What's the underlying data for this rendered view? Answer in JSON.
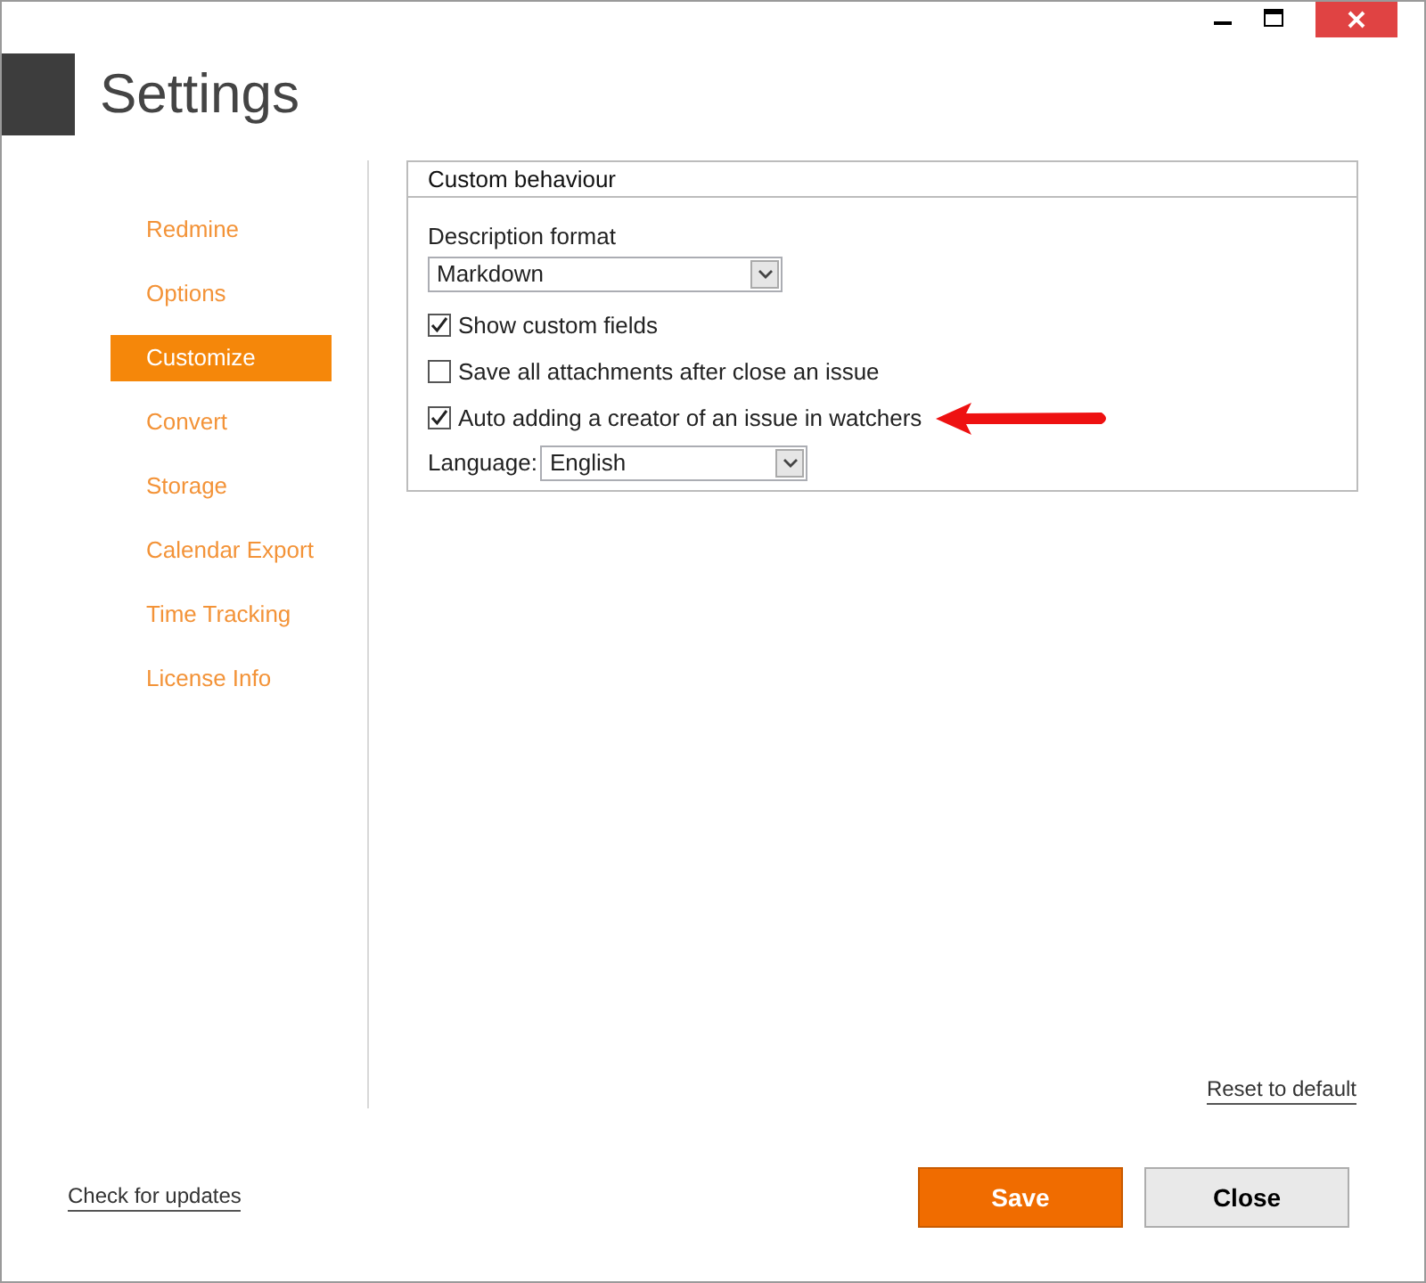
{
  "window": {
    "title": "Settings"
  },
  "sidebar": {
    "items": [
      {
        "label": "Redmine",
        "selected": false
      },
      {
        "label": "Options",
        "selected": false
      },
      {
        "label": "Customize",
        "selected": true
      },
      {
        "label": "Convert",
        "selected": false
      },
      {
        "label": "Storage",
        "selected": false
      },
      {
        "label": "Calendar Export",
        "selected": false
      },
      {
        "label": "Time Tracking",
        "selected": false
      },
      {
        "label": "License Info",
        "selected": false
      }
    ]
  },
  "group": {
    "title": "Custom behaviour",
    "rows": [
      {
        "kind": "dropdown",
        "label": "Description format",
        "value": "Markdown"
      },
      {
        "kind": "checkbox",
        "label": "Show custom fields",
        "checked": true
      },
      {
        "kind": "checkbox",
        "label": "Save all attachments after close an issue",
        "checked": false
      },
      {
        "kind": "checkbox",
        "label": "Auto adding a creator of an issue in watchers",
        "checked": true,
        "highlighted": true
      },
      {
        "kind": "inline-dropdown",
        "label": "Language:",
        "value": "English"
      }
    ]
  },
  "reset_link": "Reset to default",
  "update_link": "Check for updates",
  "buttons": [
    {
      "label": "Save",
      "kind": "primary"
    },
    {
      "label": "Close",
      "kind": "secondary"
    }
  ]
}
